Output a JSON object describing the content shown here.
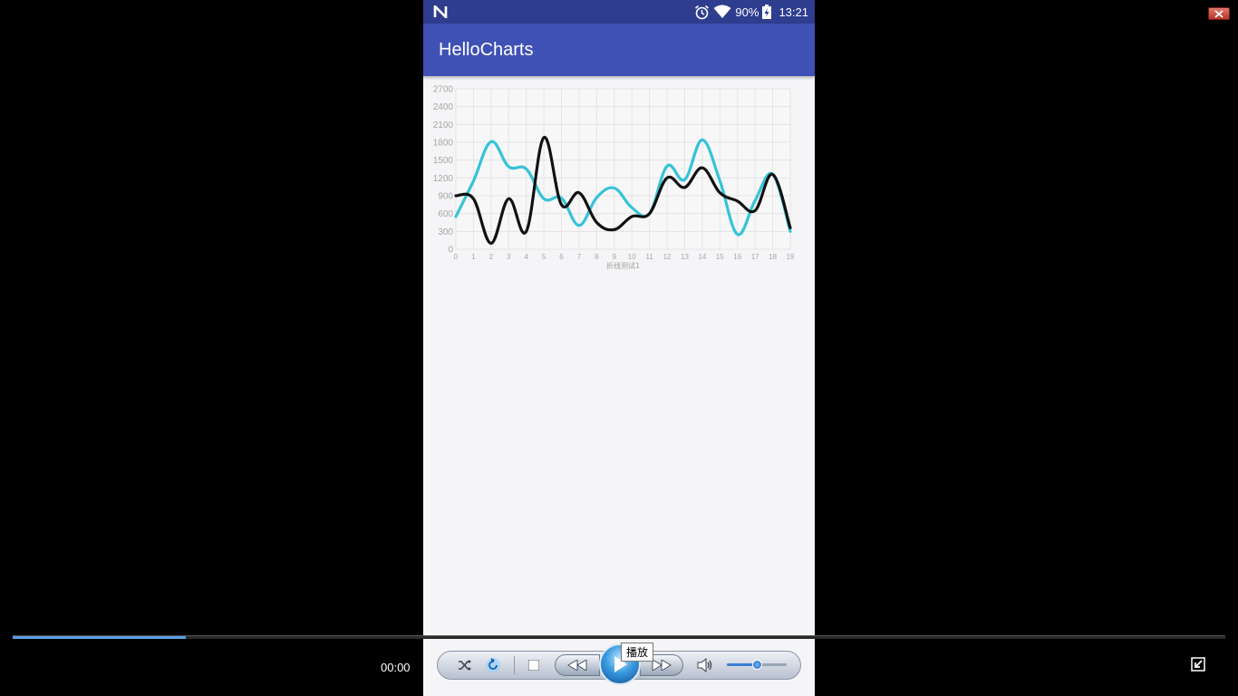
{
  "status_bar": {
    "battery": "90%",
    "time": "13:21"
  },
  "app_bar": {
    "title": "HelloCharts"
  },
  "chart_data": {
    "type": "line",
    "xlabel": "折线测试1",
    "ylabel": "",
    "x": [
      0,
      1,
      2,
      3,
      4,
      5,
      6,
      7,
      8,
      9,
      10,
      11,
      12,
      13,
      14,
      15,
      16,
      17,
      18,
      19
    ],
    "y_ticks": [
      "0",
      "300",
      "600",
      "900",
      "1200",
      "1500",
      "1800",
      "2100",
      "2400",
      "2700"
    ],
    "x_ticks": [
      "0",
      "1",
      "2",
      "3",
      "4",
      "5",
      "6",
      "7",
      "8",
      "9",
      "10",
      "11",
      "12",
      "13",
      "14",
      "15",
      "16",
      "17",
      "18",
      "19"
    ],
    "ylim": [
      0,
      2700
    ],
    "grid": true,
    "series": [
      {
        "color": "#35c3d8",
        "values": [
          550,
          1150,
          1810,
          1390,
          1350,
          850,
          860,
          400,
          870,
          1030,
          700,
          600,
          1400,
          1170,
          1840,
          1150,
          250,
          820,
          1260,
          300
        ]
      },
      {
        "color": "#111111",
        "values": [
          900,
          850,
          100,
          850,
          300,
          1880,
          750,
          950,
          450,
          330,
          550,
          600,
          1200,
          1040,
          1370,
          950,
          810,
          650,
          1260,
          360
        ]
      }
    ]
  },
  "player": {
    "current_time": "00:00",
    "tooltip": "播放",
    "progress": 0.143,
    "volume": 0.5
  }
}
